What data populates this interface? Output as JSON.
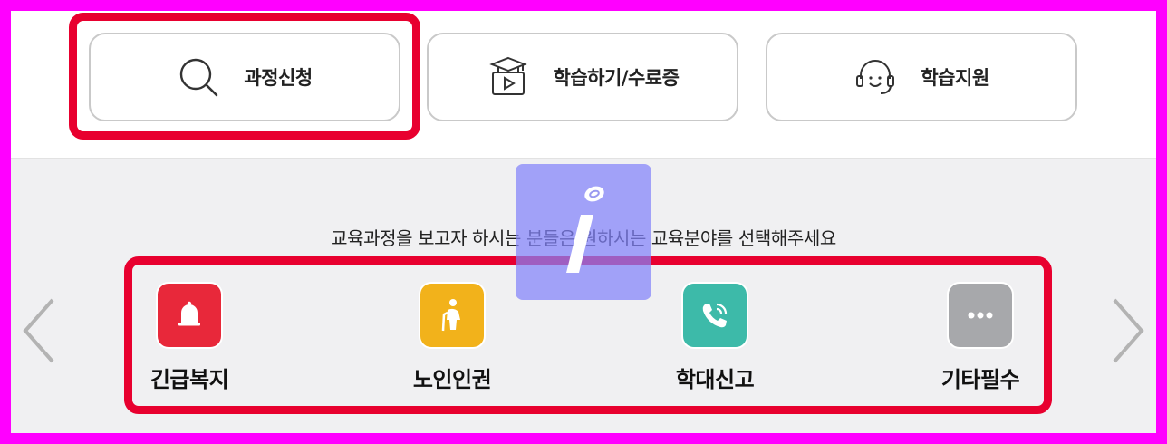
{
  "menu": {
    "apply": {
      "label": "과정신청",
      "icon": "search-icon"
    },
    "learn": {
      "label": "학습하기/수료증",
      "icon": "graduation-video-icon"
    },
    "support": {
      "label": "학습지원",
      "icon": "headset-icon"
    }
  },
  "prompt": "교육과정을 보고자 하시는 분들은 원하시는 교육분야를 선택해주세요",
  "categories": [
    {
      "label": "긴급복지",
      "icon": "bell-icon",
      "color": "#e8283a"
    },
    {
      "label": "노인인권",
      "icon": "elderly-person-icon",
      "color": "#f2b21b"
    },
    {
      "label": "학대신고",
      "icon": "phone-call-icon",
      "color": "#3dbaa9"
    },
    {
      "label": "기타필수",
      "icon": "more-dots-icon",
      "color": "#a7a8ab"
    }
  ],
  "colors": {
    "highlight": "#e8002f",
    "border": "#c9c9c9",
    "background": "#f0f0f2",
    "frame": "#ff00ff"
  }
}
